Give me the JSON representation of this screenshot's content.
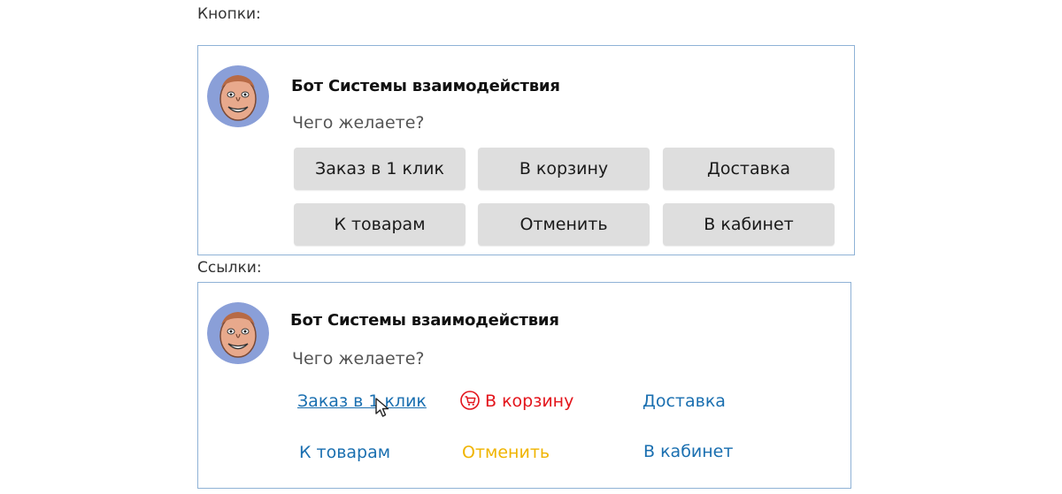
{
  "buttons_section": {
    "label": "Кнопки:",
    "bot_name": "Бот Системы взаимодействия",
    "question": "Чего желаете?",
    "buttons": [
      {
        "label": "Заказ в 1 клик"
      },
      {
        "label": "В корзину"
      },
      {
        "label": "Доставка"
      },
      {
        "label": "К товарам"
      },
      {
        "label": "Отменить"
      },
      {
        "label": "В кабинет"
      }
    ]
  },
  "links_section": {
    "label": "Ссылки:",
    "bot_name": "Бот Системы взаимодействия",
    "question": "Чего желаете?",
    "links": [
      {
        "label": "Заказ в 1 клик",
        "color": "#1a6fb0",
        "icon": ""
      },
      {
        "label": "В корзину",
        "color": "#e3141b",
        "icon": "cart-icon"
      },
      {
        "label": "Доставка",
        "color": "#1a6fb0",
        "icon": ""
      },
      {
        "label": "К товарам",
        "color": "#1a6fb0",
        "icon": ""
      },
      {
        "label": "Отменить",
        "color": "#f0b400",
        "icon": ""
      },
      {
        "label": "В кабинет",
        "color": "#1a6fb0",
        "icon": ""
      }
    ]
  },
  "colors": {
    "panel_border": "#8fb2d6",
    "button_bg": "#dedede",
    "avatar_bg": "#8a9fd8"
  }
}
